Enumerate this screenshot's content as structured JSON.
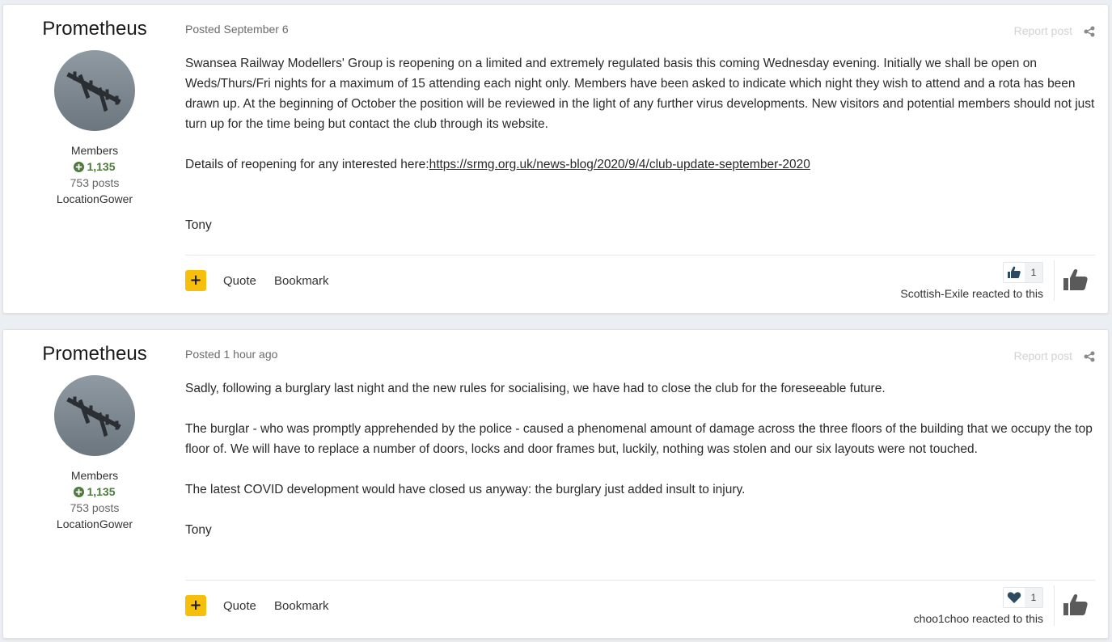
{
  "posts": [
    {
      "author": "Prometheus",
      "group": "Members",
      "reputation": "1,135",
      "post_count": "753 posts",
      "location": "LocationGower",
      "posted": "Posted September 6",
      "report_label": "Report post",
      "paragraphs": [
        "Swansea Railway Modellers' Group is reopening on a limited and extremely regulated basis this coming Wednesday evening. Initially we shall be open on Weds/Thurs/Fri nights for a maximum of 15 attending each night only. Members have been asked to indicate which night they wish to attend and a rota has been drawn up. At the beginning of October the position will be reviewed in the light of any further virus developments. New visitors and potential members should not just turn up for the time being but contact the club through its website."
      ],
      "details_prefix": "Details of reopening for any interested here:",
      "details_link": "https://srmg.org.uk/news-blog/2020/9/4/club-update-september-2020",
      "signoff": "Tony",
      "footer": {
        "plus": "+",
        "quote": "Quote",
        "bookmark": "Bookmark"
      },
      "reaction": {
        "icon": "thumbs-up-icon",
        "count": "1",
        "reacted_text": "Scottish-Exile reacted to this"
      }
    },
    {
      "author": "Prometheus",
      "group": "Members",
      "reputation": "1,135",
      "post_count": "753 posts",
      "location": "LocationGower",
      "posted": "Posted 1 hour ago",
      "report_label": "Report post",
      "paragraphs": [
        "Sadly, following a burglary last night and the new rules for socialising, we have had to close the club for the foreseeable future.",
        "The burglar - who was promptly apprehended by the police - caused a phenomenal amount of damage across the three floors of the building that we occupy the top floor of. We will have to replace a number of doors, locks and door frames but, luckily, nothing was stolen and our six layouts were not touched.",
        "The latest COVID development would have closed us anyway: the burglary just added insult to injury.",
        "Tony"
      ],
      "footer": {
        "plus": "+",
        "quote": "Quote",
        "bookmark": "Bookmark"
      },
      "reaction": {
        "icon": "heart-icon",
        "count": "1",
        "reacted_text": "choo1choo reacted to this"
      }
    }
  ],
  "colors": {
    "accent_button": "#f5bf0c",
    "reputation": "#4b7a3a",
    "reaction_icon": "#2d4a63"
  }
}
